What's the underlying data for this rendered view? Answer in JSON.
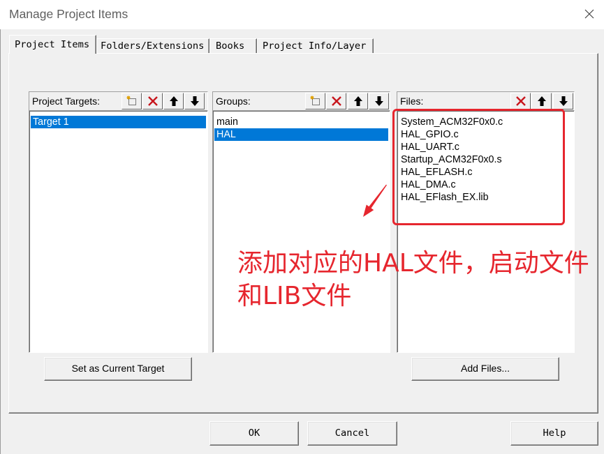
{
  "window": {
    "title": "Manage Project Items"
  },
  "icons": {
    "close": "close-icon"
  },
  "tabs": [
    {
      "label": "Project Items",
      "active": true
    },
    {
      "label": "Folders/Extensions",
      "active": false
    },
    {
      "label": "Books",
      "active": false
    },
    {
      "label": "Project Info/Layer",
      "active": false
    }
  ],
  "targets_panel": {
    "label": "Project Targets:",
    "tools": [
      "new-item-icon",
      "delete-icon",
      "arrow-up-icon",
      "arrow-down-icon"
    ],
    "items": [
      {
        "label": "Target 1",
        "selected": true
      }
    ],
    "action_label": "Set as Current Target"
  },
  "groups_panel": {
    "label": "Groups:",
    "tools": [
      "new-item-icon",
      "delete-icon",
      "arrow-up-icon",
      "arrow-down-icon"
    ],
    "items": [
      {
        "label": "main",
        "selected": false
      },
      {
        "label": "HAL",
        "selected": true
      }
    ]
  },
  "files_panel": {
    "label": "Files:",
    "tools": [
      "delete-icon",
      "arrow-up-icon",
      "arrow-down-icon"
    ],
    "items": [
      {
        "label": "System_ACM32F0x0.c",
        "selected": false
      },
      {
        "label": "HAL_GPIO.c",
        "selected": false
      },
      {
        "label": "HAL_UART.c",
        "selected": false
      },
      {
        "label": "Startup_ACM32F0x0.s",
        "selected": false
      },
      {
        "label": "HAL_EFLASH.c",
        "selected": false
      },
      {
        "label": "HAL_DMA.c",
        "selected": false
      },
      {
        "label": "HAL_EFlash_EX.lib",
        "selected": false
      }
    ],
    "action_label": "Add Files..."
  },
  "annotation": {
    "lines": [
      "添加对应的HAL文件，启动文件",
      "和LIB文件"
    ]
  },
  "footer": {
    "ok_label": "OK",
    "cancel_label": "Cancel",
    "help_label": "Help"
  },
  "colors": {
    "selection": "#0078d7",
    "annotation": "#e6262e",
    "delete_icon": "#c8161d"
  }
}
